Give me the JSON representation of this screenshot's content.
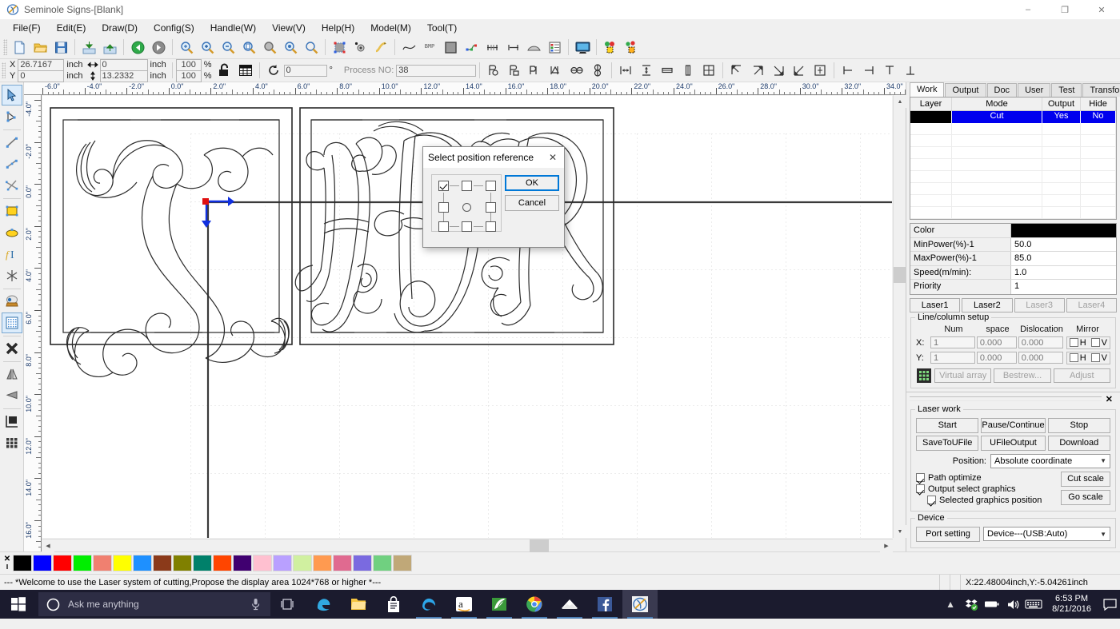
{
  "window": {
    "title": "Seminole Signs-[Blank]",
    "app_icon": "laser-app-icon",
    "minimize": "–",
    "maximize": "❐",
    "close": "✕"
  },
  "menu": {
    "items": [
      {
        "label": "File(F)"
      },
      {
        "label": "Edit(E)"
      },
      {
        "label": "Draw(D)"
      },
      {
        "label": "Config(S)"
      },
      {
        "label": "Handle(W)"
      },
      {
        "label": "View(V)"
      },
      {
        "label": "Help(H)"
      },
      {
        "label": "Model(M)"
      },
      {
        "label": "Tool(T)"
      }
    ]
  },
  "toolbar1": {
    "icons": [
      "new-file-icon",
      "open-folder-icon",
      "save-icon",
      "import-icon",
      "export-icon",
      "undo-icon",
      "redo-icon",
      "zoom-select-icon",
      "zoom-in-icon",
      "zoom-out-icon",
      "zoom-page-icon",
      "zoom-all-icon",
      "zoom-object-icon",
      "zoom-window-icon",
      "select-frame-icon",
      "node-edit-icon",
      "curve-smooth-icon",
      "bezier-icon",
      "bitmap-icon",
      "fill-icon",
      "node-join-icon",
      "measure-h-icon",
      "measure-w-icon",
      "offset-icon",
      "layer-list-icon",
      "preview-icon",
      "array-copy-icon",
      "array-paste-icon"
    ]
  },
  "coords": {
    "x_label": "X",
    "y_label": "Y",
    "x_value": "26.7167",
    "y_value": "0",
    "unit": "inch",
    "width_value": "0",
    "height_value": "13.2332",
    "scale_x": "100",
    "scale_y": "100",
    "percent": "%",
    "lock_icon": "lock-aspect-icon",
    "grid_icon": "grid-snap-icon",
    "rotate_icon": "rotate-icon",
    "angle_value": "0",
    "degree": "°",
    "process_no_label": "Process NO:",
    "process_no_value": "38"
  },
  "toolbar2": {
    "icons": [
      "mirror-h-icon",
      "mirror-v-icon",
      "rotate-left-icon",
      "rotate-right-icon",
      "flip-h-icon",
      "flip-v-icon",
      "align-center-h-icon",
      "align-center-v-icon",
      "size-equal-w-icon",
      "size-equal-h-icon",
      "size-equal-both-icon",
      "align-top-left-icon",
      "align-top-right-icon",
      "align-bottom-right-icon",
      "align-bottom-left-icon",
      "align-center-icon",
      "align-left-icon",
      "align-right-icon",
      "align-top-icon",
      "align-bottom-icon"
    ]
  },
  "left_tools": {
    "items": [
      {
        "name": "select-tool",
        "selected": true
      },
      {
        "name": "node-edit-tool",
        "selected": false
      },
      {
        "name": "line-tool",
        "selected": false
      },
      {
        "name": "polyline-tool",
        "selected": false
      },
      {
        "name": "curve-tool",
        "selected": false
      },
      {
        "name": "rectangle-tool",
        "selected": false
      },
      {
        "name": "ellipse-tool",
        "selected": false
      },
      {
        "name": "text-tool",
        "selected": false
      },
      {
        "name": "starburst-tool",
        "selected": false
      },
      {
        "name": "capture-image-tool",
        "selected": false
      },
      {
        "name": "dot-matrix-tool",
        "selected": false
      },
      {
        "name": "delete-tool",
        "selected": false
      },
      {
        "name": "mirror-horizontal-tool",
        "selected": false
      },
      {
        "name": "mirror-vertical-tool",
        "selected": false
      },
      {
        "name": "offset-tool",
        "selected": false
      },
      {
        "name": "array-tool",
        "selected": false
      }
    ]
  },
  "rulers": {
    "unit_suffix": "\"",
    "horizontal_labels": [
      "-6.0",
      "-4.0",
      "-2.0",
      "0.0",
      "2.0",
      "4.0",
      "6.0",
      "8.0",
      "10.0",
      "12.0",
      "14.0",
      "16.0",
      "18.0",
      "20.0",
      "22.0",
      "24.0",
      "26.0",
      "28.0",
      "30.0",
      "32.0",
      "34.0"
    ],
    "vertical_labels": [
      "-4.0",
      "-2.0",
      "0.0",
      "2.0",
      "4.0",
      "6.0",
      "8.0",
      "10.0",
      "12.0",
      "14.0",
      "16.0"
    ]
  },
  "canvas": {
    "origin_marker": "origin-anchor-icon",
    "artwork_1": "monogram-s-script",
    "artwork_2": "monogram-hbr-script"
  },
  "dialog": {
    "title": "Select position reference",
    "close_icon": "close-icon",
    "ok_label": "OK",
    "cancel_label": "Cancel",
    "grid_checked_index": 0,
    "positions": [
      "top-left",
      "top-center",
      "top-right",
      "middle-left",
      "center",
      "middle-right",
      "bottom-left",
      "bottom-center",
      "bottom-right"
    ]
  },
  "right_panel": {
    "tabs": [
      {
        "label": "Work",
        "active": true
      },
      {
        "label": "Output",
        "active": false
      },
      {
        "label": "Doc",
        "active": false
      },
      {
        "label": "User",
        "active": false
      },
      {
        "label": "Test",
        "active": false
      },
      {
        "label": "Transform",
        "active": false
      }
    ],
    "layer_table": {
      "headers": [
        "Layer",
        "Mode",
        "Output",
        "Hide"
      ],
      "rows": [
        {
          "color": "#000000",
          "mode": "Cut",
          "output": "Yes",
          "hide": "No",
          "selected": true
        }
      ],
      "empty_rows": 8
    },
    "properties": [
      {
        "key": "Color",
        "value": "",
        "is_swatch": true,
        "swatch_color": "#000000"
      },
      {
        "key": "MinPower(%)-1",
        "value": "50.0",
        "is_swatch": false
      },
      {
        "key": "MaxPower(%)-1",
        "value": "85.0",
        "is_swatch": false
      },
      {
        "key": "Speed(m/min):",
        "value": "1.0",
        "is_swatch": false
      },
      {
        "key": "Priority",
        "value": "1",
        "is_swatch": false
      }
    ],
    "laser_tabs": [
      {
        "label": "Laser1",
        "disabled": false
      },
      {
        "label": "Laser2",
        "disabled": false
      },
      {
        "label": "Laser3",
        "disabled": true
      },
      {
        "label": "Laser4",
        "disabled": true
      }
    ],
    "line_column": {
      "title": "Line/column setup",
      "col_headers": [
        "Num",
        "space",
        "Dislocation",
        "Mirror"
      ],
      "rows": [
        {
          "axis": "X:",
          "num": "1",
          "space": "0.000",
          "dislocation": "0.000",
          "mirror_h": "H",
          "mirror_v": "V",
          "h_checked": false,
          "v_checked": false
        },
        {
          "axis": "Y:",
          "num": "1",
          "space": "0.000",
          "dislocation": "0.000",
          "mirror_h": "H",
          "mirror_v": "V",
          "h_checked": false,
          "v_checked": false
        }
      ],
      "array_icon": "virtual-array-icon",
      "buttons": [
        {
          "label": "Virtual array",
          "disabled": true
        },
        {
          "label": "Bestrew...",
          "disabled": true
        },
        {
          "label": "Adjust",
          "disabled": true
        }
      ]
    },
    "laser_work": {
      "title": "Laser work",
      "close_icon": "panel-close-icon",
      "buttons": [
        {
          "label": "Start"
        },
        {
          "label": "Pause/Continue"
        },
        {
          "label": "Stop"
        },
        {
          "label": "SaveToUFile"
        },
        {
          "label": "UFileOutput"
        },
        {
          "label": "Download"
        }
      ],
      "position_label": "Position:",
      "position_value": "Absolute coordinate",
      "checkboxes": [
        {
          "label": "Path optimize",
          "checked": true
        },
        {
          "label": "Output select graphics",
          "checked": true
        },
        {
          "label": "Selected graphics position",
          "checked": true,
          "indented": true
        }
      ],
      "side_buttons": [
        {
          "label": "Cut scale"
        },
        {
          "label": "Go scale"
        }
      ]
    },
    "device": {
      "title": "Device",
      "port_setting_label": "Port setting",
      "device_value": "Device---(USB:Auto)"
    }
  },
  "palette": {
    "close_icon": "palette-close-icon",
    "colors": [
      "#000000",
      "#0000ff",
      "#ff0000",
      "#00ee00",
      "#f08070",
      "#ffff00",
      "#1e90ff",
      "#8b3a1a",
      "#808000",
      "#00806a",
      "#ff4500",
      "#400070",
      "#ffc0d0",
      "#b9a0ff",
      "#d0f0a0",
      "#ff9a50",
      "#e06a90",
      "#7a6ae0",
      "#70d080",
      "#c0a878"
    ]
  },
  "status_bar": {
    "message": "--- *Welcome to use the Laser system of cutting,Propose the display area 1024*768 or higher *---",
    "coordinate": "X:22.48004inch,Y:-5.04261inch"
  },
  "taskbar": {
    "start_icon": "windows-start-icon",
    "search_placeholder": "Ask me anything",
    "mic_icon": "microphone-icon",
    "task_view_icon": "task-view-icon",
    "apps": [
      {
        "name": "edge-icon",
        "open": false
      },
      {
        "name": "file-explorer-icon",
        "open": false
      },
      {
        "name": "store-icon",
        "open": false
      },
      {
        "name": "internet-explorer-icon",
        "open": true
      },
      {
        "name": "amazon-icon",
        "open": true
      },
      {
        "name": "nvidia-icon",
        "open": true
      },
      {
        "name": "chrome-icon",
        "open": true
      },
      {
        "name": "mail-icon",
        "open": true
      },
      {
        "name": "facebook-icon",
        "open": true
      },
      {
        "name": "laser-app-taskbar-icon",
        "open": true,
        "active": true
      }
    ],
    "tray": {
      "chevron_icon": "show-hidden-icons-icon",
      "dropbox_icon": "dropbox-icon",
      "battery_icon": "battery-icon",
      "volume_icon": "volume-icon",
      "keyboard_icon": "touch-keyboard-icon",
      "time": "6:53 PM",
      "date": "8/21/2016",
      "notification_icon": "action-center-icon"
    }
  }
}
